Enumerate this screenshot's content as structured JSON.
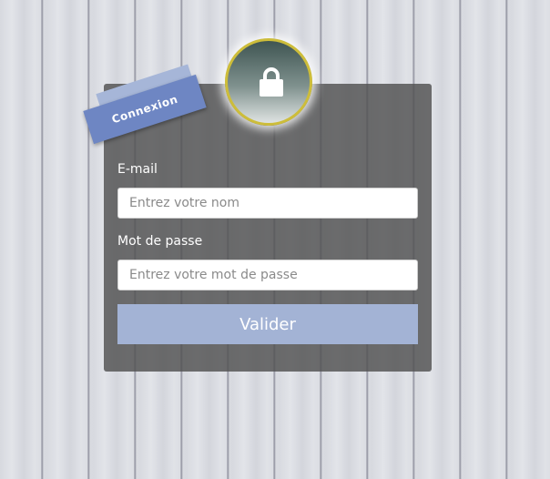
{
  "login": {
    "ribbon_label": "Connexion",
    "email_label": "E-mail",
    "email_placeholder": "Entrez votre nom",
    "password_label": "Mot de passe",
    "password_placeholder": "Entrez votre mot de passe",
    "submit_label": "Valider",
    "icon": "lock-icon"
  },
  "colors": {
    "ribbon": "#6e86c3",
    "button": "#a3b3d5",
    "panel": "#505050",
    "badge_border": "#cdbd3a"
  }
}
